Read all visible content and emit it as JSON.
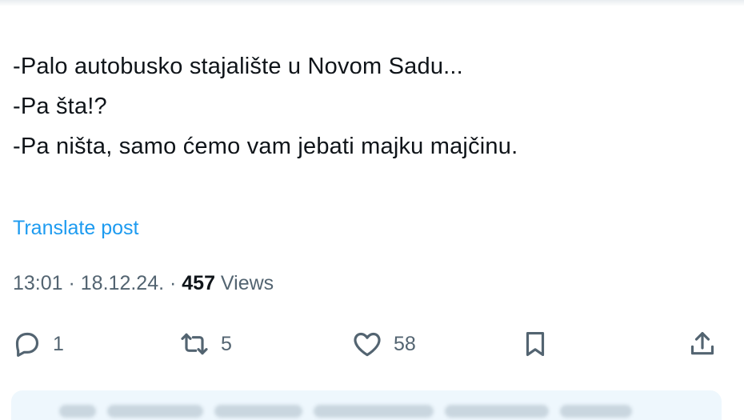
{
  "tweet": {
    "lines": [
      "-Palo autobusko stajalište u Novom Sadu...",
      "-Pa šta!?",
      "-Pa ništa, samo ćemo vam jebati majku majčinu."
    ],
    "translate_label": "Translate post",
    "time": "13:01",
    "separator": " · ",
    "date": "18.12.24.",
    "views_count": "457",
    "views_label": " Views"
  },
  "actions": {
    "replies": "1",
    "reposts": "5",
    "likes": "58"
  },
  "colors": {
    "text": "#0f1419",
    "secondary": "#536471",
    "link": "#1d9bf0",
    "panel": "#eef7fd"
  },
  "icons": [
    "reply-icon",
    "repost-icon",
    "like-icon",
    "bookmark-icon",
    "share-icon"
  ]
}
